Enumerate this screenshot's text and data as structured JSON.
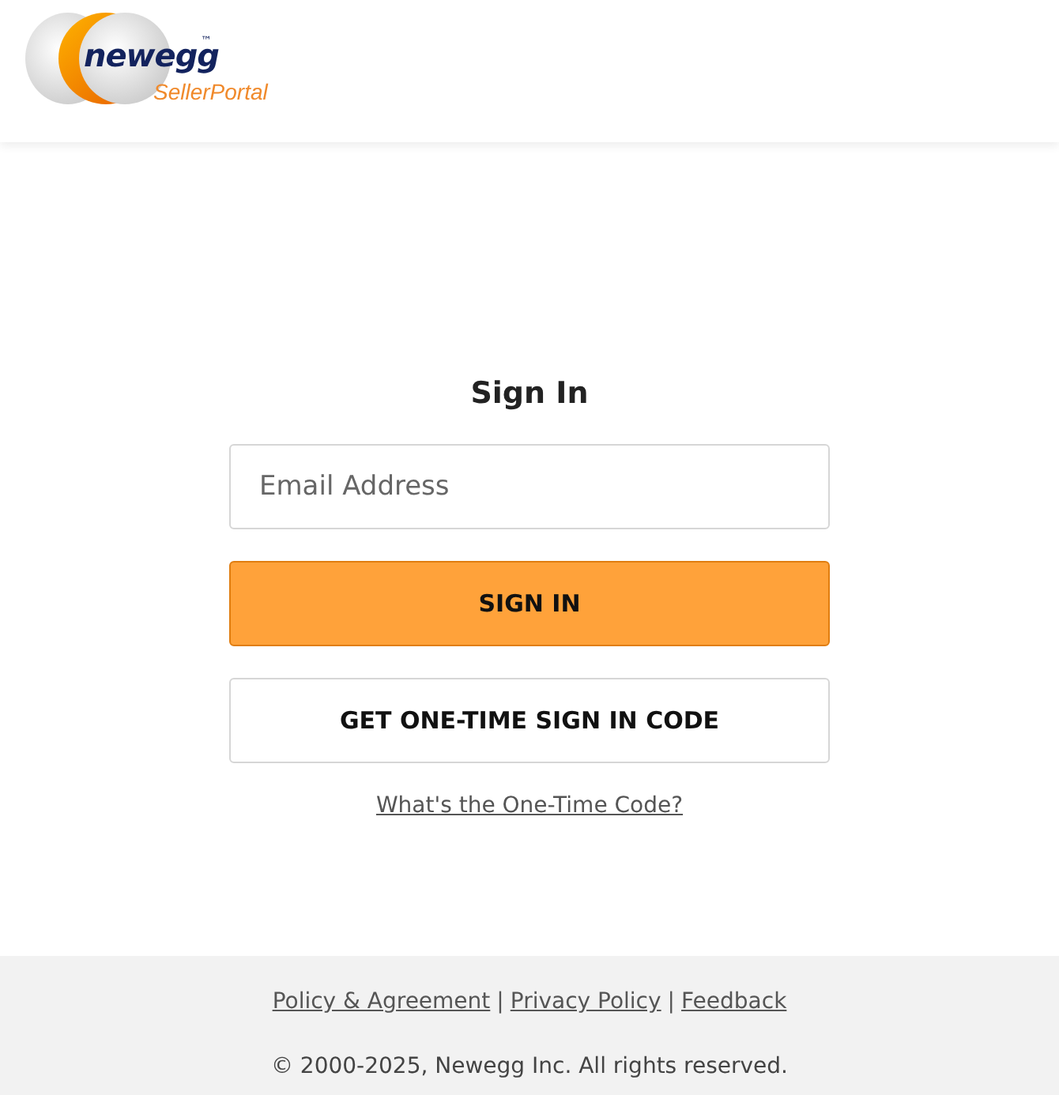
{
  "header": {
    "logo": {
      "brand": "newegg",
      "trademark": "™",
      "product": "SellerPortal"
    }
  },
  "sign_in": {
    "title": "Sign In",
    "email_field": {
      "placeholder": "Email Address"
    },
    "buttons": [
      {
        "kind": "primary",
        "label": "SIGN IN"
      },
      {
        "kind": "secondary",
        "label": "GET ONE-TIME SIGN IN CODE"
      }
    ],
    "help_link": "What's the One-Time Code?"
  },
  "footer": {
    "items": [
      {
        "kind": "link",
        "text": "Policy & Agreement"
      },
      {
        "kind": "separator",
        "text": "|"
      },
      {
        "kind": "link",
        "text": "Privacy Policy"
      },
      {
        "kind": "separator",
        "text": "|"
      },
      {
        "kind": "link",
        "text": "Feedback"
      }
    ],
    "copyright": "© 2000-2025, Newegg Inc. All rights reserved."
  }
}
